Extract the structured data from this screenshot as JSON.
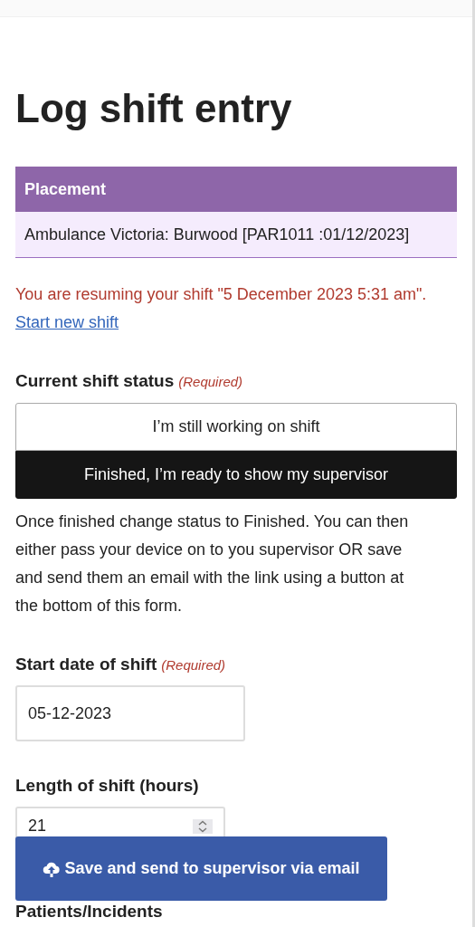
{
  "title": "Log shift entry",
  "placement": {
    "header": "Placement",
    "value": "Ambulance Victoria: Burwood [PAR1011 :01/12/2023]"
  },
  "notice": "You are resuming your shift \"5 December 2023 5:31 am\".",
  "start_new_link": "Start new shift",
  "status": {
    "label": "Current shift status",
    "required": "(Required)",
    "options": [
      {
        "label": "I’m still working on shift",
        "selected": false
      },
      {
        "label": "Finished, I’m ready to show my supervisor",
        "selected": true
      }
    ]
  },
  "help": "Once finished change status to Finished. You can then either pass your device on to you supervisor OR save and send them an email with the link using a button at the bottom of this form.",
  "start_date": {
    "label": "Start date of shift",
    "required": "(Required)",
    "value": "05-12-2023"
  },
  "length": {
    "label": "Length of shift (hours)",
    "value": "21"
  },
  "save_button": "Save and send to supervisor via email",
  "next_section": "Patients/Incidents"
}
